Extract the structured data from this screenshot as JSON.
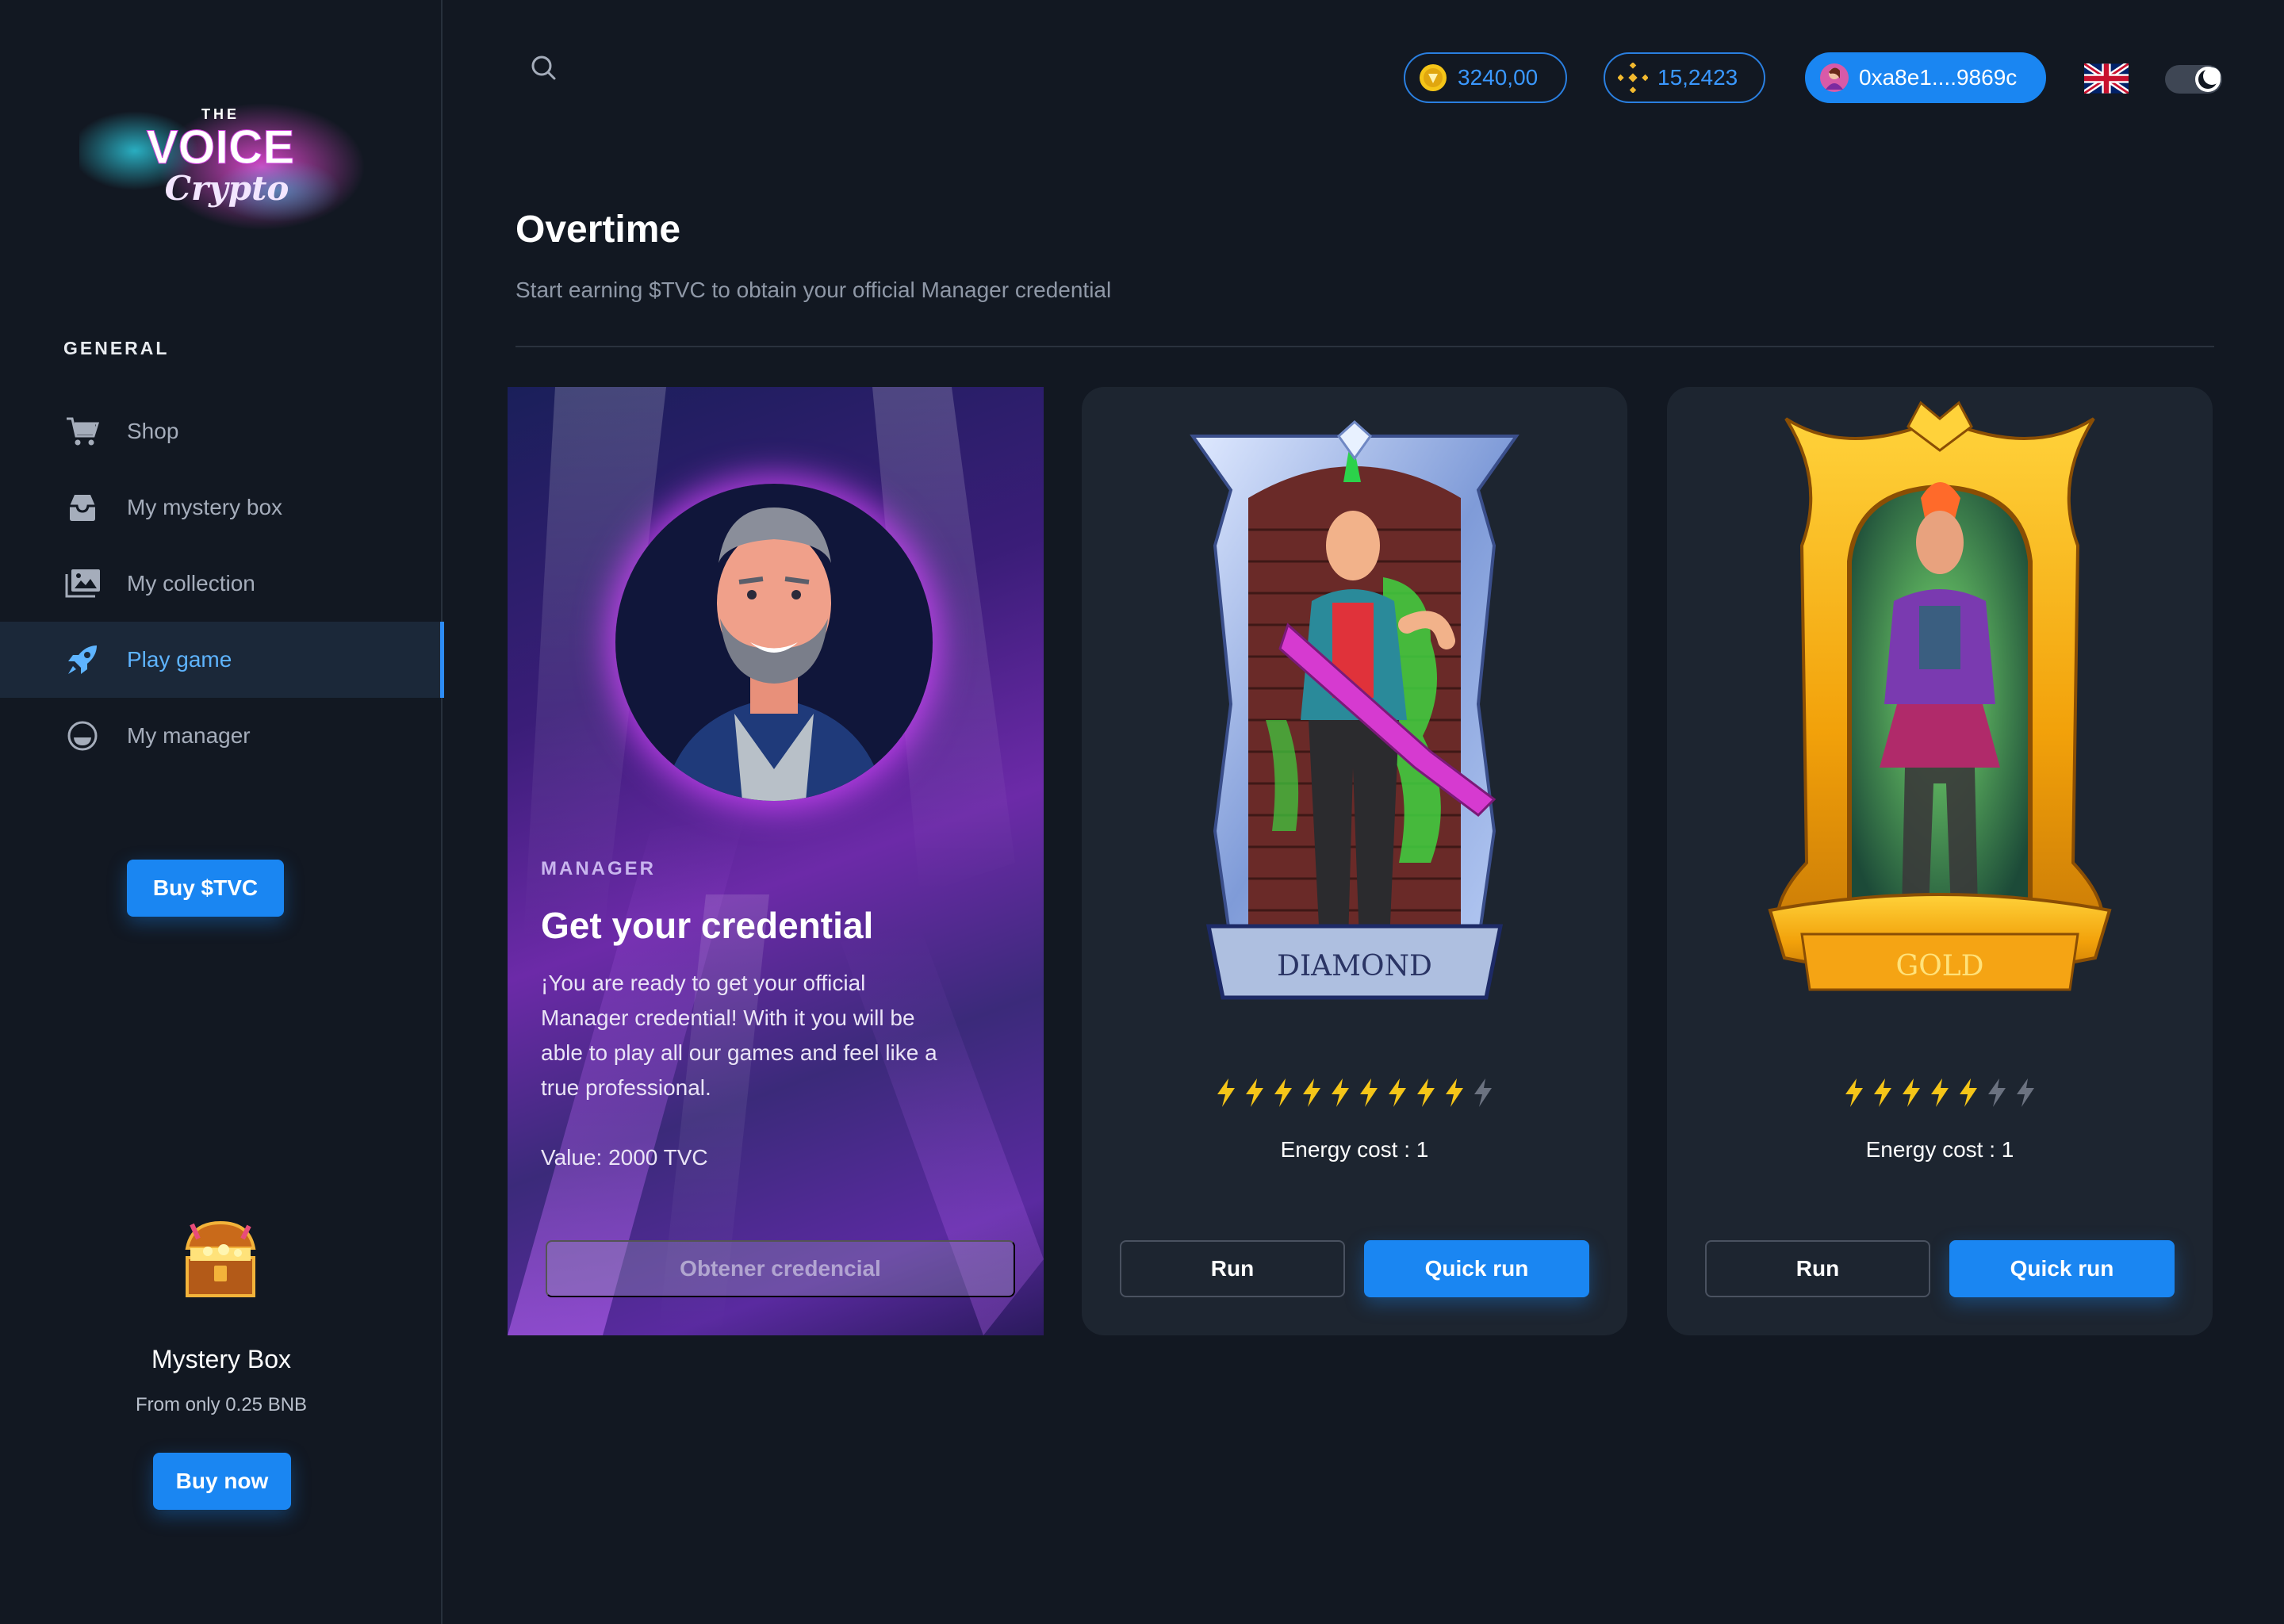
{
  "app": {
    "logo_text": {
      "top": "THE",
      "main": "VOICE",
      "script": "Crypto"
    }
  },
  "sidebar": {
    "section_title": "GENERAL",
    "items": [
      {
        "label": "Shop",
        "icon": "cart-icon",
        "active": false
      },
      {
        "label": "My mystery box",
        "icon": "inbox-icon",
        "active": false
      },
      {
        "label": "My collection",
        "icon": "gallery-icon",
        "active": false
      },
      {
        "label": "Play game",
        "icon": "rocket-icon",
        "active": true
      },
      {
        "label": "My manager",
        "icon": "manager-icon",
        "active": false
      }
    ],
    "buy_tvc_label": "Buy $TVC",
    "mystery_box": {
      "title": "Mystery Box",
      "subtitle": "From only 0.25 BNB",
      "button_label": "Buy now"
    }
  },
  "header": {
    "tvc_balance": "3240,00",
    "bnb_balance": "15,2423",
    "wallet_address": "0xa8e1....9869c",
    "language": "uk-flag-icon",
    "theme": "dark"
  },
  "main": {
    "title": "Overtime",
    "subtitle": "Start earning $TVC to obtain your official Manager credential",
    "manager_card": {
      "label": "MANAGER",
      "title": "Get your credential",
      "description": "¡You are ready to get your official Manager credential! With it you will be able to play all our games and feel like a true professional.",
      "value": "Value: 2000 TVC",
      "button_label": "Obtener credencial"
    },
    "cards": [
      {
        "tier": "DIAMOND",
        "energy_filled": 9,
        "energy_total": 10,
        "energy_cost": "Energy cost : 1",
        "run_label": "Run",
        "quick_run_label": "Quick run"
      },
      {
        "tier": "GOLD",
        "energy_filled": 5,
        "energy_total": 7,
        "energy_cost": "Energy cost : 1",
        "run_label": "Run",
        "quick_run_label": "Quick run"
      }
    ]
  },
  "colors": {
    "accent": "#1a86f2",
    "bg": "#121822",
    "card": "#1d2530",
    "active_nav": "#5eb4ff",
    "energy_on": "#f5c518",
    "energy_off": "#6b7280"
  }
}
